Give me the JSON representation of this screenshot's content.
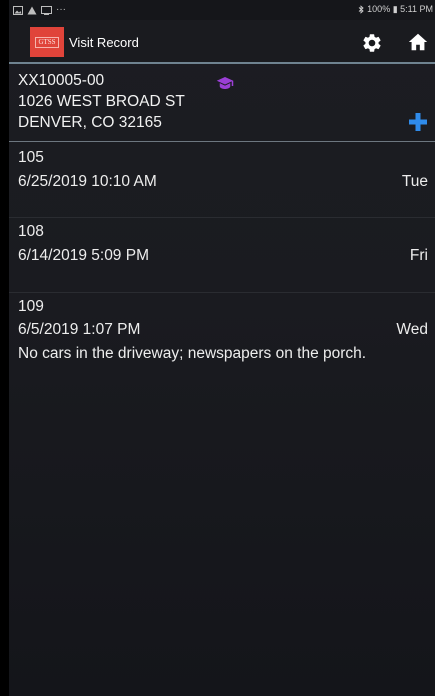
{
  "status_bar": {
    "left_icons": [
      "image-icon",
      "warning-icon",
      "cast-icon",
      "more-icon"
    ],
    "right_text": "100% ▮ 5:11 PM",
    "battery_pct": "100%",
    "time": "5:11 PM"
  },
  "header": {
    "logo_text": "GTSS",
    "title": "Visit Record"
  },
  "address": {
    "account": "XX10005-00",
    "street": "1026 WEST BROAD ST",
    "city": "DENVER, CO 32165"
  },
  "visits": [
    {
      "id": "105",
      "datetime": "6/25/2019  10:10 AM",
      "day": "Tue",
      "note": ""
    },
    {
      "id": "108",
      "datetime": "6/14/2019  5:09 PM",
      "day": "Fri",
      "note": ""
    },
    {
      "id": "109",
      "datetime": "6/5/2019  1:07 PM",
      "day": "Wed",
      "note": "No cars in the driveway; newspapers on the porch."
    }
  ],
  "colors": {
    "accent_blue": "#2f8bea",
    "cap_purple": "#9b3fd6",
    "logo_red": "#e0443a"
  }
}
